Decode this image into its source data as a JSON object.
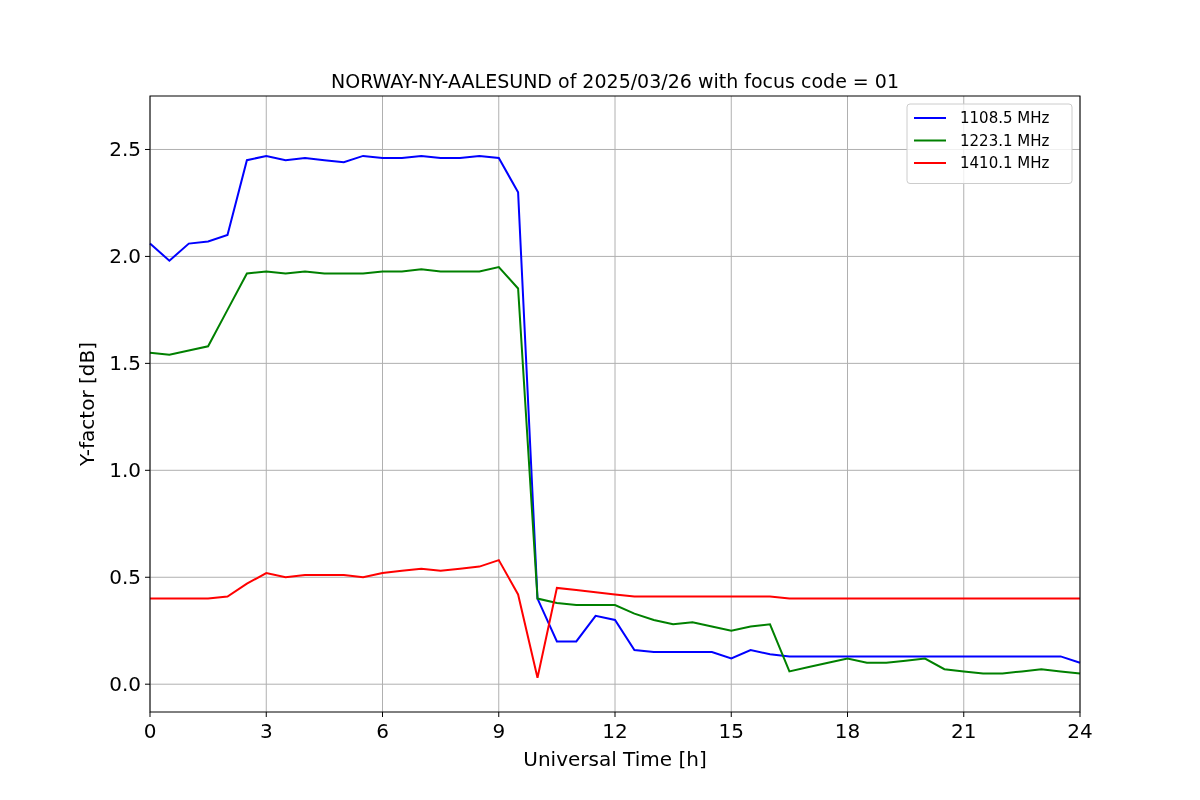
{
  "chart_data": {
    "type": "line",
    "title": "NORWAY-NY-AALESUND of 2025/03/26 with focus code = 01",
    "xlabel": "Universal Time [h]",
    "ylabel": "Y-factor [dB]",
    "x": [
      0,
      0.5,
      1,
      1.5,
      2,
      2.5,
      3,
      3.5,
      4,
      4.5,
      5,
      5.5,
      6,
      6.5,
      7,
      7.5,
      8,
      8.5,
      9,
      9.5,
      10,
      10.5,
      11,
      11.5,
      12,
      12.5,
      13,
      13.5,
      14,
      14.5,
      15,
      15.5,
      16,
      16.5,
      17,
      17.5,
      18,
      18.5,
      19,
      19.5,
      20,
      20.5,
      21,
      21.5,
      22,
      22.5,
      23,
      23.5,
      24
    ],
    "series": [
      {
        "name": "1108.5 MHz",
        "color": "#0000ff",
        "values": [
          2.06,
          1.98,
          2.06,
          2.07,
          2.1,
          2.45,
          2.47,
          2.45,
          2.46,
          2.45,
          2.44,
          2.47,
          2.46,
          2.46,
          2.47,
          2.46,
          2.46,
          2.47,
          2.46,
          2.3,
          0.4,
          0.2,
          0.2,
          0.32,
          0.3,
          0.16,
          0.15,
          0.15,
          0.15,
          0.15,
          0.12,
          0.16,
          0.14,
          0.13,
          0.13,
          0.13,
          0.13,
          0.13,
          0.13,
          0.13,
          0.13,
          0.13,
          0.13,
          0.13,
          0.13,
          0.13,
          0.13,
          0.13,
          0.1
        ]
      },
      {
        "name": "1223.1 MHz",
        "color": "#008000",
        "values": [
          1.55,
          1.54,
          1.56,
          1.58,
          1.75,
          1.92,
          1.93,
          1.92,
          1.93,
          1.92,
          1.92,
          1.92,
          1.93,
          1.93,
          1.94,
          1.93,
          1.93,
          1.93,
          1.95,
          1.85,
          0.4,
          0.38,
          0.37,
          0.37,
          0.37,
          0.33,
          0.3,
          0.28,
          0.29,
          0.27,
          0.25,
          0.27,
          0.28,
          0.06,
          0.08,
          0.1,
          0.12,
          0.1,
          0.1,
          0.11,
          0.12,
          0.07,
          0.06,
          0.05,
          0.05,
          0.06,
          0.07,
          0.06,
          0.05
        ]
      },
      {
        "name": "1410.1 MHz",
        "color": "#ff0000",
        "values": [
          0.4,
          0.4,
          0.4,
          0.4,
          0.41,
          0.47,
          0.52,
          0.5,
          0.51,
          0.51,
          0.51,
          0.5,
          0.52,
          0.53,
          0.54,
          0.53,
          0.54,
          0.55,
          0.58,
          0.42,
          0.03,
          0.45,
          0.44,
          0.43,
          0.42,
          0.41,
          0.41,
          0.41,
          0.41,
          0.41,
          0.41,
          0.41,
          0.41,
          0.4,
          0.4,
          0.4,
          0.4,
          0.4,
          0.4,
          0.4,
          0.4,
          0.4,
          0.4,
          0.4,
          0.4,
          0.4,
          0.4,
          0.4,
          0.4
        ]
      }
    ],
    "grid": true,
    "legend": true,
    "xlim": [
      0,
      24
    ],
    "ylim": [
      -0.13,
      2.75
    ],
    "xticks": [
      0,
      3,
      6,
      9,
      12,
      15,
      18,
      21,
      24
    ],
    "yticks": [
      {
        "value": 0,
        "label": "0.0"
      },
      {
        "value": 0.5,
        "label": "0.5"
      },
      {
        "value": 1,
        "label": "1.0"
      },
      {
        "value": 1.5,
        "label": "1.5"
      },
      {
        "value": 2,
        "label": "2.0"
      },
      {
        "value": 2.5,
        "label": "2.5"
      }
    ]
  }
}
